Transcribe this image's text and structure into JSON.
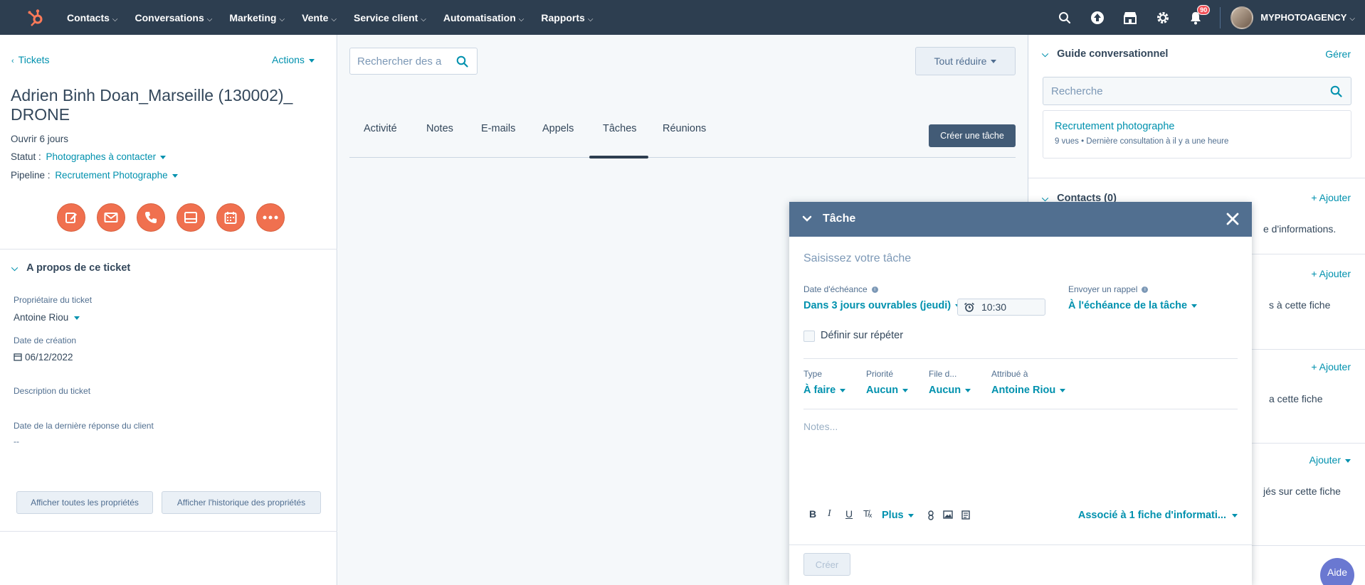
{
  "topnav": {
    "items": [
      {
        "label": "Contacts"
      },
      {
        "label": "Conversations"
      },
      {
        "label": "Marketing"
      },
      {
        "label": "Vente"
      },
      {
        "label": "Service client"
      },
      {
        "label": "Automatisation"
      },
      {
        "label": "Rapports"
      }
    ],
    "notifications_count": "90",
    "account_name": "MYPHOTOAGENCY"
  },
  "left": {
    "back_label": "Tickets",
    "actions_label": "Actions",
    "title": "Adrien Binh Doan_Marseille (130002)_ DRONE",
    "open_for": "Ouvrir 6 jours",
    "status_label": "Statut :",
    "status_value": "Photographes à contacter",
    "pipeline_label": "Pipeline :",
    "pipeline_value": "Recrutement Photographe",
    "about_section": "A propos de ce ticket",
    "owner_label": "Propriétaire du ticket",
    "owner_value": "Antoine Riou",
    "created_label": "Date de création",
    "created_value": "06/12/2022",
    "description_label": "Description du ticket",
    "last_reply_label": "Date de la dernière réponse du client",
    "last_reply_value": "--",
    "show_all_props": "Afficher toutes les propriétés",
    "show_history": "Afficher l'historique des propriétés"
  },
  "middle": {
    "search_placeholder": "Rechercher des a",
    "collapse_all": "Tout réduire",
    "tabs": [
      {
        "label": "Activité"
      },
      {
        "label": "Notes"
      },
      {
        "label": "E-mails"
      },
      {
        "label": "Appels"
      },
      {
        "label": "Tâches"
      },
      {
        "label": "Réunions"
      }
    ],
    "active_tab": "Tâches",
    "create_task": "Créer une tâche"
  },
  "right": {
    "guide_title": "Guide conversationnel",
    "manage": "Gérer",
    "search_placeholder": "Recherche",
    "guide_item_title": "Recrutement photographe",
    "guide_item_sub": "9 vues • Dernière consultation à il y a une heure",
    "contacts_title": "Contacts (0)",
    "add": "+ Ajouter",
    "add2": "+ Ajouter",
    "add3": "+ Ajouter",
    "add4": "Ajouter",
    "frag1": "e d'informations.",
    "frag2": "s à cette fiche",
    "frag3": "a cette fiche",
    "frag4": "jés sur cette fiche"
  },
  "task": {
    "header_title": "Tâche",
    "input_placeholder": "Saisissez votre tâche",
    "due_label": "Date d'échéance",
    "due_value": "Dans 3 jours ouvrables (jeudi)",
    "time_value": "10:30",
    "reminder_label": "Envoyer un rappel",
    "reminder_value": "À l'échéance de la tâche",
    "repeat_label": "Définir sur répéter",
    "type_label": "Type",
    "type_value": "À faire",
    "priority_label": "Priorité",
    "priority_value": "Aucun",
    "queue_label": "File d...",
    "queue_value": "Aucun",
    "assigned_label": "Attribué à",
    "assigned_value": "Antoine Riou",
    "notes_placeholder": "Notes...",
    "more_label": "Plus",
    "associated_label": "Associé à 1 fiche d'informati...",
    "create_label": "Créer"
  },
  "help_label": "Aide",
  "colors": {
    "nav_bg": "#2d3e50",
    "accent": "#0091ae",
    "action_orange": "#f0704f",
    "modal_header": "#516f90",
    "badge": "#f2545b"
  }
}
